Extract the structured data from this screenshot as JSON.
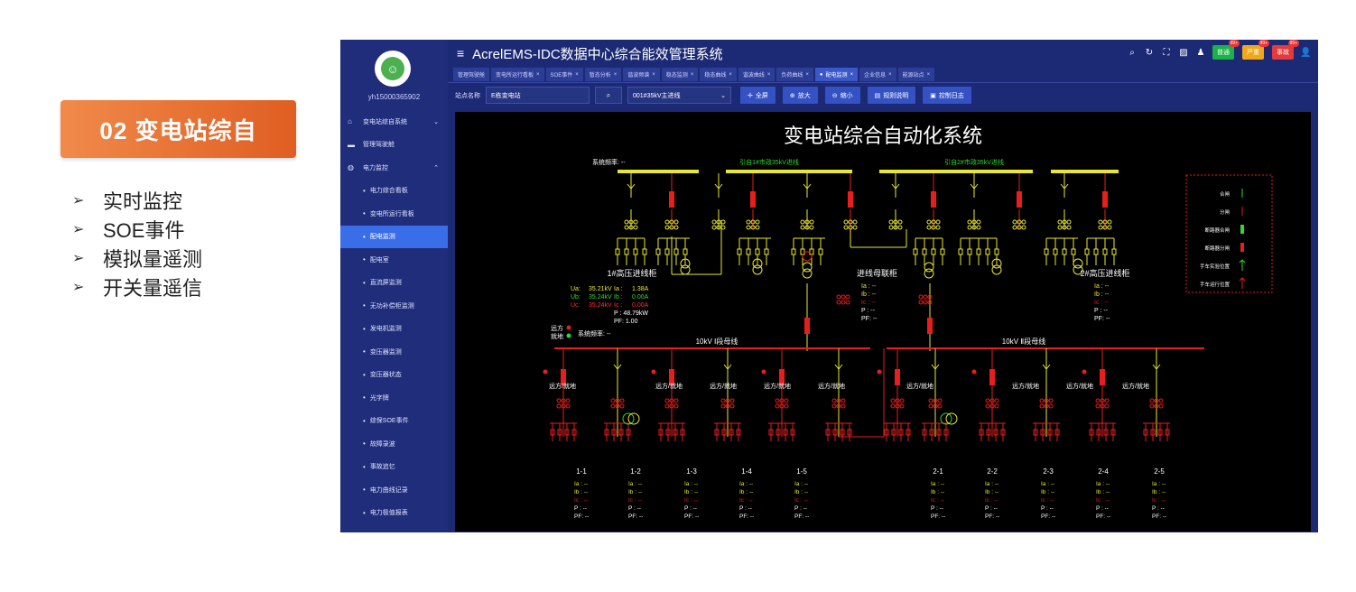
{
  "slide": {
    "badge": "02 变电站综自",
    "features": [
      "实时监控",
      "SOE事件",
      "模拟量遥测",
      "开关量遥信"
    ]
  },
  "app": {
    "title": "AcrelEMS-IDC数据中心综合能效管理系统",
    "username": "yh15000365902",
    "badges": [
      {
        "label": "普通",
        "count": "99+",
        "color": "#19b34a"
      },
      {
        "label": "严重",
        "count": "99+",
        "color": "#f0a818"
      },
      {
        "label": "事故",
        "count": "99+",
        "color": "#e33b3b"
      }
    ]
  },
  "sidebar": {
    "items": [
      {
        "label": "变电站综自系统",
        "level": "top",
        "icon": "home-icon",
        "glyph": "⌂",
        "caret": "⌄"
      },
      {
        "label": "管理驾驶舱",
        "level": "top",
        "icon": "monitor-icon",
        "glyph": "▬",
        "caret": ""
      },
      {
        "label": "电力监控",
        "level": "top",
        "icon": "globe-icon",
        "glyph": "◍",
        "caret": "⌃"
      },
      {
        "label": "电力综合看板",
        "level": "sub"
      },
      {
        "label": "变电所运行看板",
        "level": "sub"
      },
      {
        "label": "配电监测",
        "level": "sub",
        "active": true
      },
      {
        "label": "配电室",
        "level": "sub"
      },
      {
        "label": "直流屏监测",
        "level": "sub"
      },
      {
        "label": "无功补偿柜监测",
        "level": "sub"
      },
      {
        "label": "发电机监测",
        "level": "sub"
      },
      {
        "label": "变压器监测",
        "level": "sub"
      },
      {
        "label": "变压器状态",
        "level": "sub"
      },
      {
        "label": "光字牌",
        "level": "sub"
      },
      {
        "label": "综保SOE事件",
        "level": "sub"
      },
      {
        "label": "故障录波",
        "level": "sub"
      },
      {
        "label": "事故追忆",
        "level": "sub"
      },
      {
        "label": "电力曲线记录",
        "level": "sub"
      },
      {
        "label": "电力极值报表",
        "level": "sub"
      }
    ]
  },
  "tabs": [
    {
      "label": "管理驾驶舱",
      "closable": false
    },
    {
      "label": "变电所运行看板",
      "closable": true
    },
    {
      "label": "SOE事件",
      "closable": true
    },
    {
      "label": "暂态分析",
      "closable": true
    },
    {
      "label": "谐波频谱",
      "closable": true
    },
    {
      "label": "稳态监测",
      "closable": true
    },
    {
      "label": "稳态曲线",
      "closable": true
    },
    {
      "label": "谐波曲线",
      "closable": true
    },
    {
      "label": "负荷曲线",
      "closable": true
    },
    {
      "label": "配电监测",
      "closable": true,
      "active": true
    },
    {
      "label": "企业信息",
      "closable": true
    },
    {
      "label": "能源站点",
      "closable": true
    }
  ],
  "toolbar": {
    "station_label": "站点名称",
    "station_value": "E栋变电站",
    "line_value": "001#35kV主进线",
    "buttons": [
      {
        "label": "全屏",
        "icon": "expand-icon",
        "glyph": "✛"
      },
      {
        "label": "放大",
        "icon": "zoom-in-icon",
        "glyph": "⊕"
      },
      {
        "label": "缩小",
        "icon": "zoom-out-icon",
        "glyph": "⊖"
      },
      {
        "label": "规则说明",
        "icon": "doc-icon",
        "glyph": "▤"
      },
      {
        "label": "控制日志",
        "icon": "log-icon",
        "glyph": "▣"
      }
    ]
  },
  "diagram": {
    "title": "变电站综合自动化系统",
    "sys_freq_label": "系统频率: --",
    "incoming1_label": "引自1#市政35kV进线",
    "incoming2_label": "引自2#市政35kV进线",
    "cab1_label": "1#高压进线柜",
    "cab2_label": "2#高压进线柜",
    "tie_label": "进线母联柜",
    "measures1": [
      {
        "k": "Ua:",
        "v": "35.21kV",
        "k2": "Ia :",
        "v2": "1.38A",
        "color": "#e8e830"
      },
      {
        "k": "Ub:",
        "v": "35.24kV",
        "k2": "Ib :",
        "v2": "0.00A",
        "color": "#38d838"
      },
      {
        "k": "Uc:",
        "v": "35.24kV",
        "k2": "Ic :",
        "v2": "0.00A",
        "color": "#ff3030"
      }
    ],
    "p1": "P :  48.79kW",
    "pf1": "PF:  1.00",
    "remote_label": "远方",
    "local_label": "就地",
    "sys_freq2": "系统频率: --",
    "bus1_label": "10kV Ⅰ段母线",
    "bus2_label": "10kV Ⅱ段母线",
    "feeder_state": "远方/就地",
    "feeders_left": [
      "1-1",
      "1-2",
      "1-3",
      "1-4",
      "1-5"
    ],
    "feeders_right": [
      "2-1",
      "2-2",
      "2-3",
      "2-4",
      "2-5"
    ],
    "meas_labels": [
      "Ia :  --",
      "Ib :  --",
      "Ic :  --",
      "P :  --",
      "PF:  --"
    ],
    "legend": [
      "合闸",
      "分闸",
      "断路器合闸",
      "断路器分闸",
      "手车实验位置",
      "手车运行位置"
    ]
  }
}
